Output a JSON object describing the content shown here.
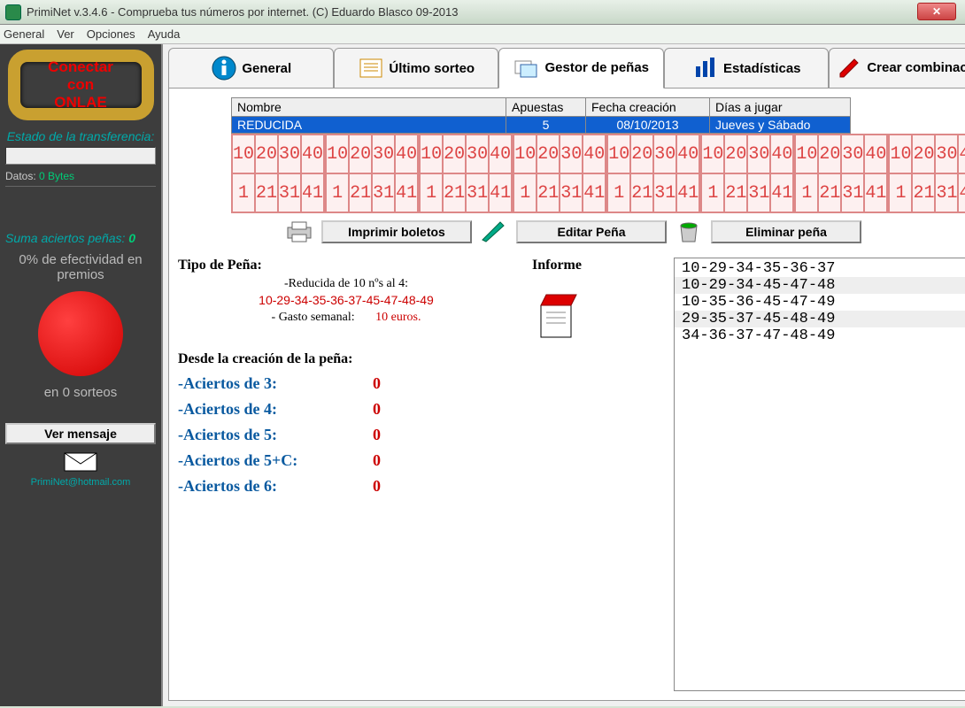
{
  "titlebar": {
    "title": "PrimiNet v.3.4.6 - Comprueba tus números por internet. (C) Eduardo Blasco 09-2013"
  },
  "menu": {
    "items": [
      "General",
      "Ver",
      "Opciones",
      "Ayuda"
    ]
  },
  "sidebar": {
    "connect_l1": "Conectar",
    "connect_l2": "con",
    "connect_l3": "ONLAE",
    "status_label": "Estado de la transferencia:",
    "datos_label": "Datos:",
    "datos_value": "0 Bytes",
    "aciertos_label": "Suma aciertos peñas:",
    "aciertos_value": "0",
    "efectividad": "0% de efectividad en premios",
    "sorteos": "en 0 sorteos",
    "ver_mensaje": "Ver mensaje",
    "mail": "PrimiNet@hotmail.com"
  },
  "tabs": {
    "general": "General",
    "ultimo": "Último sorteo",
    "gestor": "Gestor de peñas",
    "estad": "Estadísticas",
    "crear": "Crear combinación"
  },
  "grid": {
    "headers": [
      "Nombre",
      "Apuestas",
      "Fecha creación",
      "Días a jugar"
    ],
    "row": {
      "nombre": "REDUCIDA",
      "apuestas": "5",
      "fecha": "08/10/2013",
      "dias": "Jueves y Sábado"
    }
  },
  "actions": {
    "imprimir": "Imprimir boletos",
    "editar": "Editar Peña",
    "eliminar": "Eliminar peña"
  },
  "tipo": {
    "head": "Tipo de Peña:",
    "sub": "-Reducida de 10 nºs al 4:",
    "nums": "10-29-34-35-36-37-45-47-48-49",
    "gasto_label": "- Gasto semanal:",
    "gasto_value": "10 euros."
  },
  "desde": {
    "head": "Desde la creación de la peña:",
    "rows": [
      {
        "label": "-Aciertos de 3:",
        "value": "0"
      },
      {
        "label": "-Aciertos de 4:",
        "value": "0"
      },
      {
        "label": "-Aciertos de 5:",
        "value": "0"
      },
      {
        "label": "-Aciertos de 5+C:",
        "value": "0"
      },
      {
        "label": "-Aciertos de 6:",
        "value": "0"
      }
    ]
  },
  "informe": {
    "head": "Informe"
  },
  "combos": [
    "10-29-34-35-36-37",
    "10-29-34-45-47-48",
    "10-35-36-45-47-49",
    "29-35-37-45-48-49",
    "34-36-37-47-48-49"
  ],
  "ticket_cells": [
    [
      "10",
      "20",
      "30",
      "40"
    ],
    [
      "1",
      "21",
      "31",
      "41"
    ]
  ]
}
